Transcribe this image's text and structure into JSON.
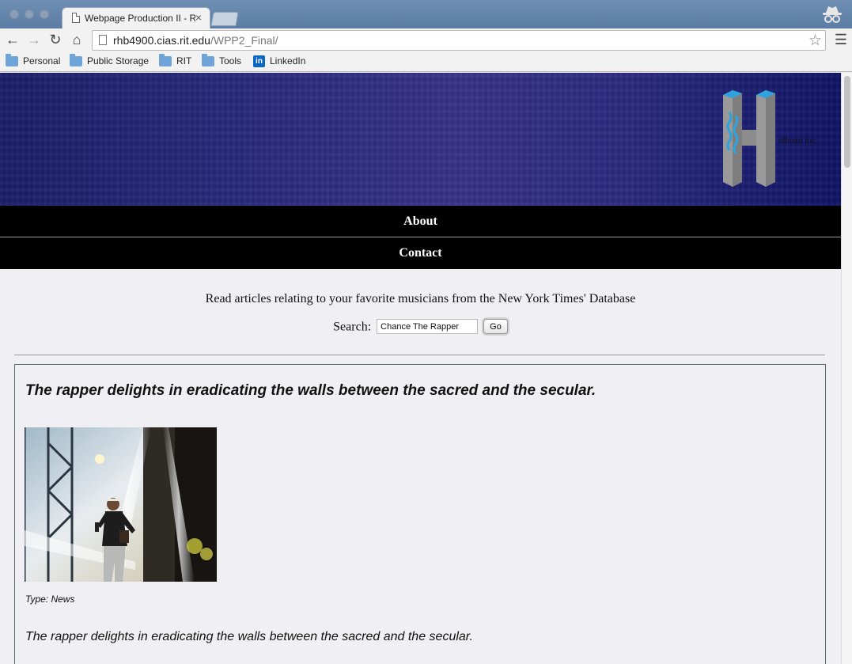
{
  "browser": {
    "tab_title": "Webpage Production II - R",
    "url_host": "rhb4900.cias.rit.edu",
    "url_path": "/WPP2_Final/",
    "bookmarks": [
      {
        "label": "Personal",
        "icon": "folder-icon"
      },
      {
        "label": "Public Storage",
        "icon": "folder-icon"
      },
      {
        "label": "RIT",
        "icon": "folder-icon"
      },
      {
        "label": "Tools",
        "icon": "folder-icon"
      },
      {
        "label": "LinkedIn",
        "icon": "linkedin-icon"
      }
    ]
  },
  "header": {
    "logo_text": "offman Inc."
  },
  "nav": {
    "about": "About",
    "contact": "Contact"
  },
  "main": {
    "intro": "Read articles relating to your favorite musicians from the New York Times' Database",
    "search_label": "Search:",
    "search_value": "Chance The Rapper",
    "go_label": "Go"
  },
  "article": {
    "headline": "The rapper delights in eradicating the walls between the sacred and the secular.",
    "type": "Type: News",
    "abstract": "The rapper delights in eradicating the walls between the sacred and the secular."
  },
  "colors": {
    "banner": "#2a2b7e",
    "nav_bg": "#000000",
    "page_bg": "#f0eff3",
    "chrome_blue": "#6f8fb4"
  }
}
